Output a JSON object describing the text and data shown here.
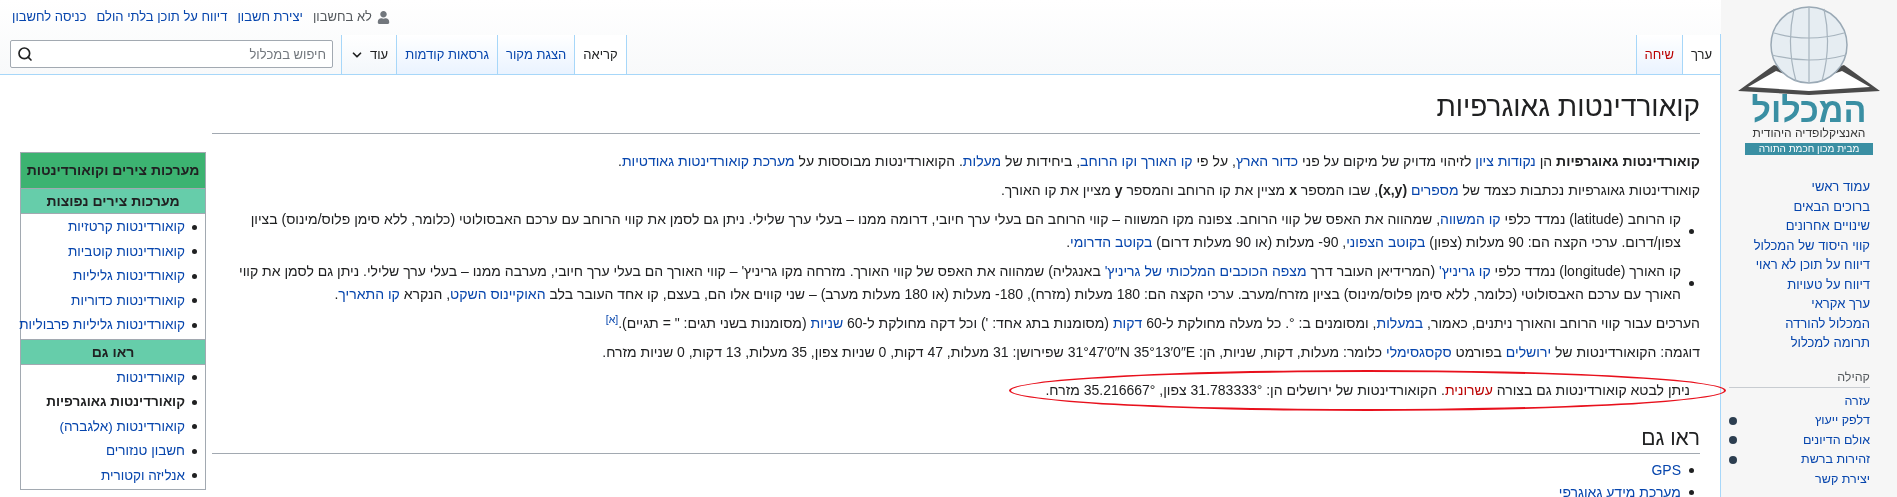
{
  "personal": {
    "status": "לא בחשבון",
    "links": [
      "יצירת חשבון",
      "דיווח על תוכן בלתי הולם",
      "כניסה לחשבון"
    ]
  },
  "namespace_tabs": [
    {
      "label": "ערך",
      "selected": true,
      "exists": true
    },
    {
      "label": "שיחה",
      "selected": false,
      "exists": false
    }
  ],
  "view_tabs": [
    {
      "label": "קריאה",
      "selected": true
    },
    {
      "label": "הצגת מקור",
      "selected": false
    },
    {
      "label": "גרסאות קודמות",
      "selected": false
    }
  ],
  "more_menu": "עוד",
  "search": {
    "placeholder": "חיפוש במכלול"
  },
  "logo": {
    "name": "המכלול",
    "tagline": "האנציקלופדיה היהודית",
    "publisher": "מבית מכון חכמת התורה"
  },
  "navigation": [
    "עמוד ראשי",
    "ברוכים הבאים",
    "שינויים אחרונים",
    "קווי היסוד של המכלול",
    "דיווח על תוכן לא ראוי",
    "דיווח על טעויות",
    "ערך אקראי",
    "המכלול להורדה",
    "תרומה למכלול"
  ],
  "community": {
    "heading": "קהילה",
    "items": [
      {
        "label": "עזרה",
        "bullet": false
      },
      {
        "label": "דלפק ייעוץ",
        "bullet": true
      },
      {
        "label": "אולם הדיונים",
        "bullet": true
      },
      {
        "label": "זהירות ברשת",
        "bullet": true
      },
      {
        "label": "יצירת קשר",
        "bullet": false
      }
    ]
  },
  "title": "קואורדינטות גאוגרפיות",
  "paragraphs": [
    {
      "kind": "p",
      "circled": false,
      "segments": [
        {
          "kind": "bold",
          "t": "קואורדינטות גאוגרפיות"
        },
        {
          "kind": "text",
          "t": " הן "
        },
        {
          "kind": "link",
          "t": "נקודות ציון"
        },
        {
          "kind": "text",
          "t": " לזיהוי מדויק של מיקום על פני "
        },
        {
          "kind": "link",
          "t": "כדור הארץ"
        },
        {
          "kind": "text",
          "t": ", על פי "
        },
        {
          "kind": "link",
          "t": "קו האורך וקו הרוחב"
        },
        {
          "kind": "text",
          "t": ", ביחידות של "
        },
        {
          "kind": "link",
          "t": "מעלות"
        },
        {
          "kind": "text",
          "t": ". הקואורדינטות מבוססות על "
        },
        {
          "kind": "link",
          "t": "מערכת קואורדינטות גאודטיות"
        },
        {
          "kind": "text",
          "t": "."
        }
      ]
    },
    {
      "kind": "p",
      "circled": false,
      "segments": [
        {
          "kind": "text",
          "t": "קואורדינטות גאוגרפיות נכתבות כצמד של "
        },
        {
          "kind": "link",
          "t": "מספרים"
        },
        {
          "kind": "bold",
          "t": " (x,y)"
        },
        {
          "kind": "text",
          "t": ", שבו המספר "
        },
        {
          "kind": "bold",
          "t": "x"
        },
        {
          "kind": "text",
          "t": " מציין את קו הרוחב והמספר "
        },
        {
          "kind": "bold",
          "t": "y"
        },
        {
          "kind": "text",
          "t": " מציין את קו האורך."
        }
      ]
    },
    {
      "kind": "bullet",
      "circled": false,
      "segments": [
        {
          "kind": "text",
          "t": "קו הרוחב (latitude) נמדד כלפי "
        },
        {
          "kind": "link",
          "t": "קו המשווה"
        },
        {
          "kind": "text",
          "t": ", שמהווה את האפס של קווי הרוחב. צפונה מקו המשווה – קווי הרוחב הם בעלי ערך חיובי, דרומה ממנו – בעלי ערך שלילי. ניתן גם לסמן את קווי הרוחב עם ערכם האבסולוטי (כלומר, ללא סימן פלוס/מינוס) בציון צפון/דרום. ערכי הקצה הם: 90 מעלות (צפון) "
        },
        {
          "kind": "link",
          "t": "בקוטב הצפוני"
        },
        {
          "kind": "text",
          "t": ", 90- מעלות (או 90 מעלות דרום) "
        },
        {
          "kind": "link",
          "t": "בקוטב הדרומי"
        },
        {
          "kind": "text",
          "t": "."
        }
      ]
    },
    {
      "kind": "bullet",
      "circled": false,
      "segments": [
        {
          "kind": "text",
          "t": "קו האורך (longitude) נמדד כלפי "
        },
        {
          "kind": "link",
          "t": "קו גריניץ'"
        },
        {
          "kind": "text",
          "t": " (המרידיאן העובר דרך "
        },
        {
          "kind": "link",
          "t": "מצפה הכוכבים המלכותי של גריניץ'"
        },
        {
          "kind": "text",
          "t": " באנגליה) שמהווה את האפס של קווי האורך. מזרחה מקו גריניץ' – קווי האורך הם בעלי ערך חיובי, מערבה ממנו – בעלי ערך שלילי. ניתן גם לסמן את קווי האורך עם ערכם האבסולוטי (כלומר, ללא סימן פלוס/מינוס) בציון מזרח/מערב. ערכי הקצה הם: 180 מעלות (מזרח), 180- מעלות (או 180 מעלות מערב) – שני קווים אלו הם, בעצם, קו אחד העובר בלב "
        },
        {
          "kind": "link",
          "t": "האוקיינוס השקט"
        },
        {
          "kind": "text",
          "t": ", הנקרא "
        },
        {
          "kind": "link",
          "t": "קו התאריך"
        },
        {
          "kind": "text",
          "t": "."
        }
      ]
    },
    {
      "kind": "p",
      "circled": false,
      "segments": [
        {
          "kind": "text",
          "t": "הערכים עבור קווי הרוחב והאורך ניתנים, כאמור, "
        },
        {
          "kind": "link",
          "t": "במעלות"
        },
        {
          "kind": "text",
          "t": ", ומסומנים ב: °. כל מעלה מחולקת ל-60 "
        },
        {
          "kind": "link",
          "t": "דקות"
        },
        {
          "kind": "text",
          "t": " (מסומנות בתג אחד: ') וכל דקה מחולקת ל-60 "
        },
        {
          "kind": "link",
          "t": "שניות"
        },
        {
          "kind": "text",
          "t": " (מסומנות בשני תגים: \" = תגיים)."
        },
        {
          "kind": "ref",
          "t": "[א]"
        }
      ]
    },
    {
      "kind": "p",
      "circled": false,
      "segments": [
        {
          "kind": "text",
          "t": "דוגמה: הקואורדינטות של "
        },
        {
          "kind": "link",
          "t": "ירושלים"
        },
        {
          "kind": "text",
          "t": " בפורמט "
        },
        {
          "kind": "link",
          "t": "סקסגסימלי"
        },
        {
          "kind": "text",
          "t": " כלומר: מעלות, דקות, שניות, הן: 31°47′0″N 35°13′0″E שפירושן: 31 מעלות, 47 דקות, 0 שניות צפון, 35 מעלות, 13 דקות, 0 שניות מזרח."
        }
      ]
    },
    {
      "kind": "p",
      "circled": true,
      "segments": [
        {
          "kind": "text",
          "t": "ניתן לבטא קואורדינטות גם בצורה "
        },
        {
          "kind": "redlink",
          "t": "עשרונית"
        },
        {
          "kind": "text",
          "t": ". הקואורדינטות של ירושלים הן: 31.783333° צפון, 35.216667° מזרח."
        }
      ]
    }
  ],
  "see_also": {
    "heading": "ראו גם",
    "items": [
      "GPS",
      "מערכת מידע גאוגרפי"
    ]
  },
  "infobox": {
    "title": "מערכות צירים וקואורדינטות",
    "sections": [
      {
        "heading": "מערכות צירים נפוצות",
        "items": [
          {
            "label": "קואורדינטות קרטזיות",
            "current": false
          },
          {
            "label": "קואורדינטות קוטביות",
            "current": false
          },
          {
            "label": "קואורדינטות גליליות",
            "current": false
          },
          {
            "label": "קואורדינטות כדוריות",
            "current": false
          },
          {
            "label": "קואורדינטות גליליות פרבוליות",
            "current": false
          }
        ]
      },
      {
        "heading": "ראו גם",
        "items": [
          {
            "label": "קואורדינטות",
            "current": false
          },
          {
            "label": "קואורדינטות גאוגרפיות",
            "current": true
          },
          {
            "label": "קואורדינטות (אלגברה)",
            "current": false
          },
          {
            "label": "חשבון טנזורים",
            "current": false
          },
          {
            "label": "אנליזה וקטורית",
            "current": false
          }
        ]
      }
    ]
  }
}
